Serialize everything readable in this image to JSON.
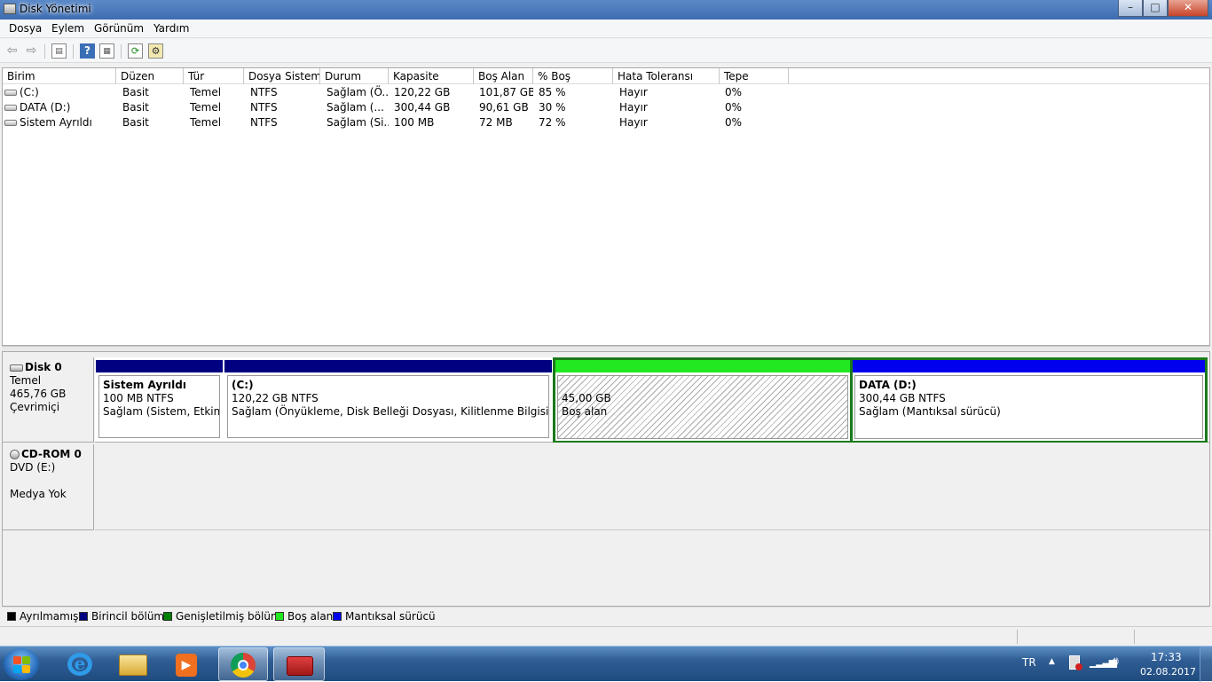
{
  "window": {
    "title": "Disk Yönetimi",
    "minimize": "–",
    "maximize": "□",
    "close": "✕"
  },
  "menu": [
    "Dosya",
    "Eylem",
    "Görünüm",
    "Yardım"
  ],
  "toolbar": {
    "icons": [
      "back-arrow-icon",
      "forward-arrow-icon",
      "console-tree-icon",
      "help-icon",
      "properties-icon",
      "refresh-icon",
      "settings-icon"
    ]
  },
  "volume_table": {
    "columns": [
      "Birim",
      "Düzen",
      "Tür",
      "Dosya Sistemi",
      "Durum",
      "Kapasite",
      "Boş Alan",
      "% Boş",
      "Hata Toleransı",
      "Tepe"
    ],
    "rows": [
      [
        "(C:)",
        "Basit",
        "Temel",
        "NTFS",
        "Sağlam (Ö...",
        "120,22 GB",
        "101,87 GB",
        "85 %",
        "Hayır",
        "0%"
      ],
      [
        "DATA (D:)",
        "Basit",
        "Temel",
        "NTFS",
        "Sağlam (...",
        "300,44 GB",
        "90,61 GB",
        "30 %",
        "Hayır",
        "0%"
      ],
      [
        "Sistem Ayrıldı",
        "Basit",
        "Temel",
        "NTFS",
        "Sağlam (Si...",
        "100 MB",
        "72 MB",
        "72 %",
        "Hayır",
        "0%"
      ]
    ]
  },
  "disk0": {
    "name": "Disk 0",
    "type": "Temel",
    "size": "465,76 GB",
    "status": "Çevrimiçi",
    "partitions": [
      {
        "name": "Sistem Ayrıldı",
        "size": "100 MB NTFS",
        "status": "Sağlam (Sistem, Etkin, Bi",
        "bar_color": "#000080"
      },
      {
        "name": "(C:)",
        "size": "120,22 GB NTFS",
        "status": "Sağlam (Önyükleme, Disk Belleği Dosyası, Kilitlenme Bilgisi, Birincil",
        "bar_color": "#000080"
      },
      {
        "name": "",
        "size": "45,00 GB",
        "status": "Boş alan",
        "bar_color": "#22e822"
      },
      {
        "name": "DATA  (D:)",
        "size": "300,44 GB NTFS",
        "status": "Sağlam (Mantıksal sürücü)",
        "bar_color": "#0000ee"
      }
    ]
  },
  "cdrom0": {
    "name": "CD-ROM 0",
    "type": "DVD (E:)",
    "status": "Medya Yok"
  },
  "legend": [
    {
      "label": "Ayrılmamış",
      "color": "#000000"
    },
    {
      "label": "Birincil bölüm",
      "color": "#000080"
    },
    {
      "label": "Genişletilmiş bölüm",
      "color": "#008000"
    },
    {
      "label": "Boş alan",
      "color": "#22e822"
    },
    {
      "label": "Mantıksal sürücü",
      "color": "#0000ee"
    }
  ],
  "taskbar": {
    "apps": [
      "internet-explorer-icon",
      "file-explorer-icon",
      "media-player-icon",
      "chrome-icon",
      "computer-management-icon"
    ],
    "lang": "TR",
    "time": "17:33",
    "date": "02.08.2017"
  }
}
